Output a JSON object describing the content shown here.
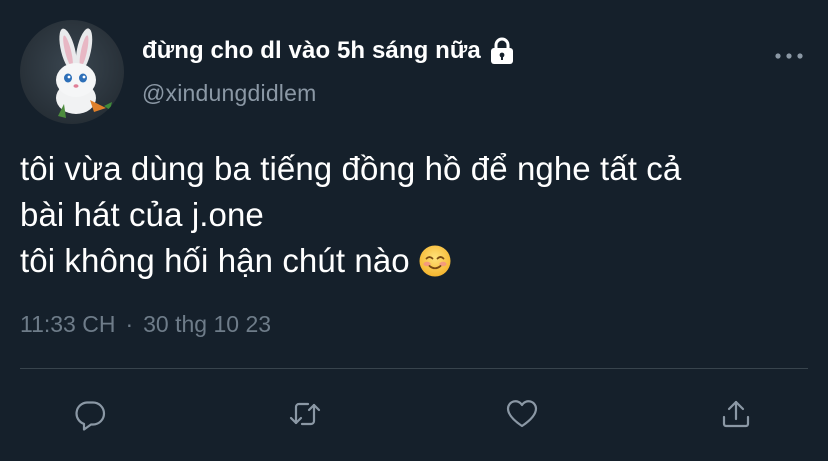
{
  "author": {
    "display_name": "đừng cho dl vào 5h sáng nữa",
    "handle": "@xindungdidlem",
    "protected_icon": "lock-icon",
    "avatar_icon": "bunny-avatar"
  },
  "tweet": {
    "lines": [
      "tôi vừa dùng ba tiếng đồng hồ để nghe tất cả",
      "bài hát của j.one",
      "tôi không hối hận chút nào"
    ],
    "emoji": "smiling-face-emoji",
    "time": "11:33 CH",
    "separator": "·",
    "date": "30 thg 10 23"
  },
  "actions": [
    {
      "icon": "reply-icon"
    },
    {
      "icon": "retweet-icon"
    },
    {
      "icon": "like-icon"
    },
    {
      "icon": "share-icon"
    }
  ],
  "more_icon": "more-options-icon",
  "colors": {
    "background": "#15202b",
    "text_primary": "#ffffff",
    "text_secondary": "#8b98a5",
    "icon": "#8b98a5",
    "divider": "#38444d"
  }
}
